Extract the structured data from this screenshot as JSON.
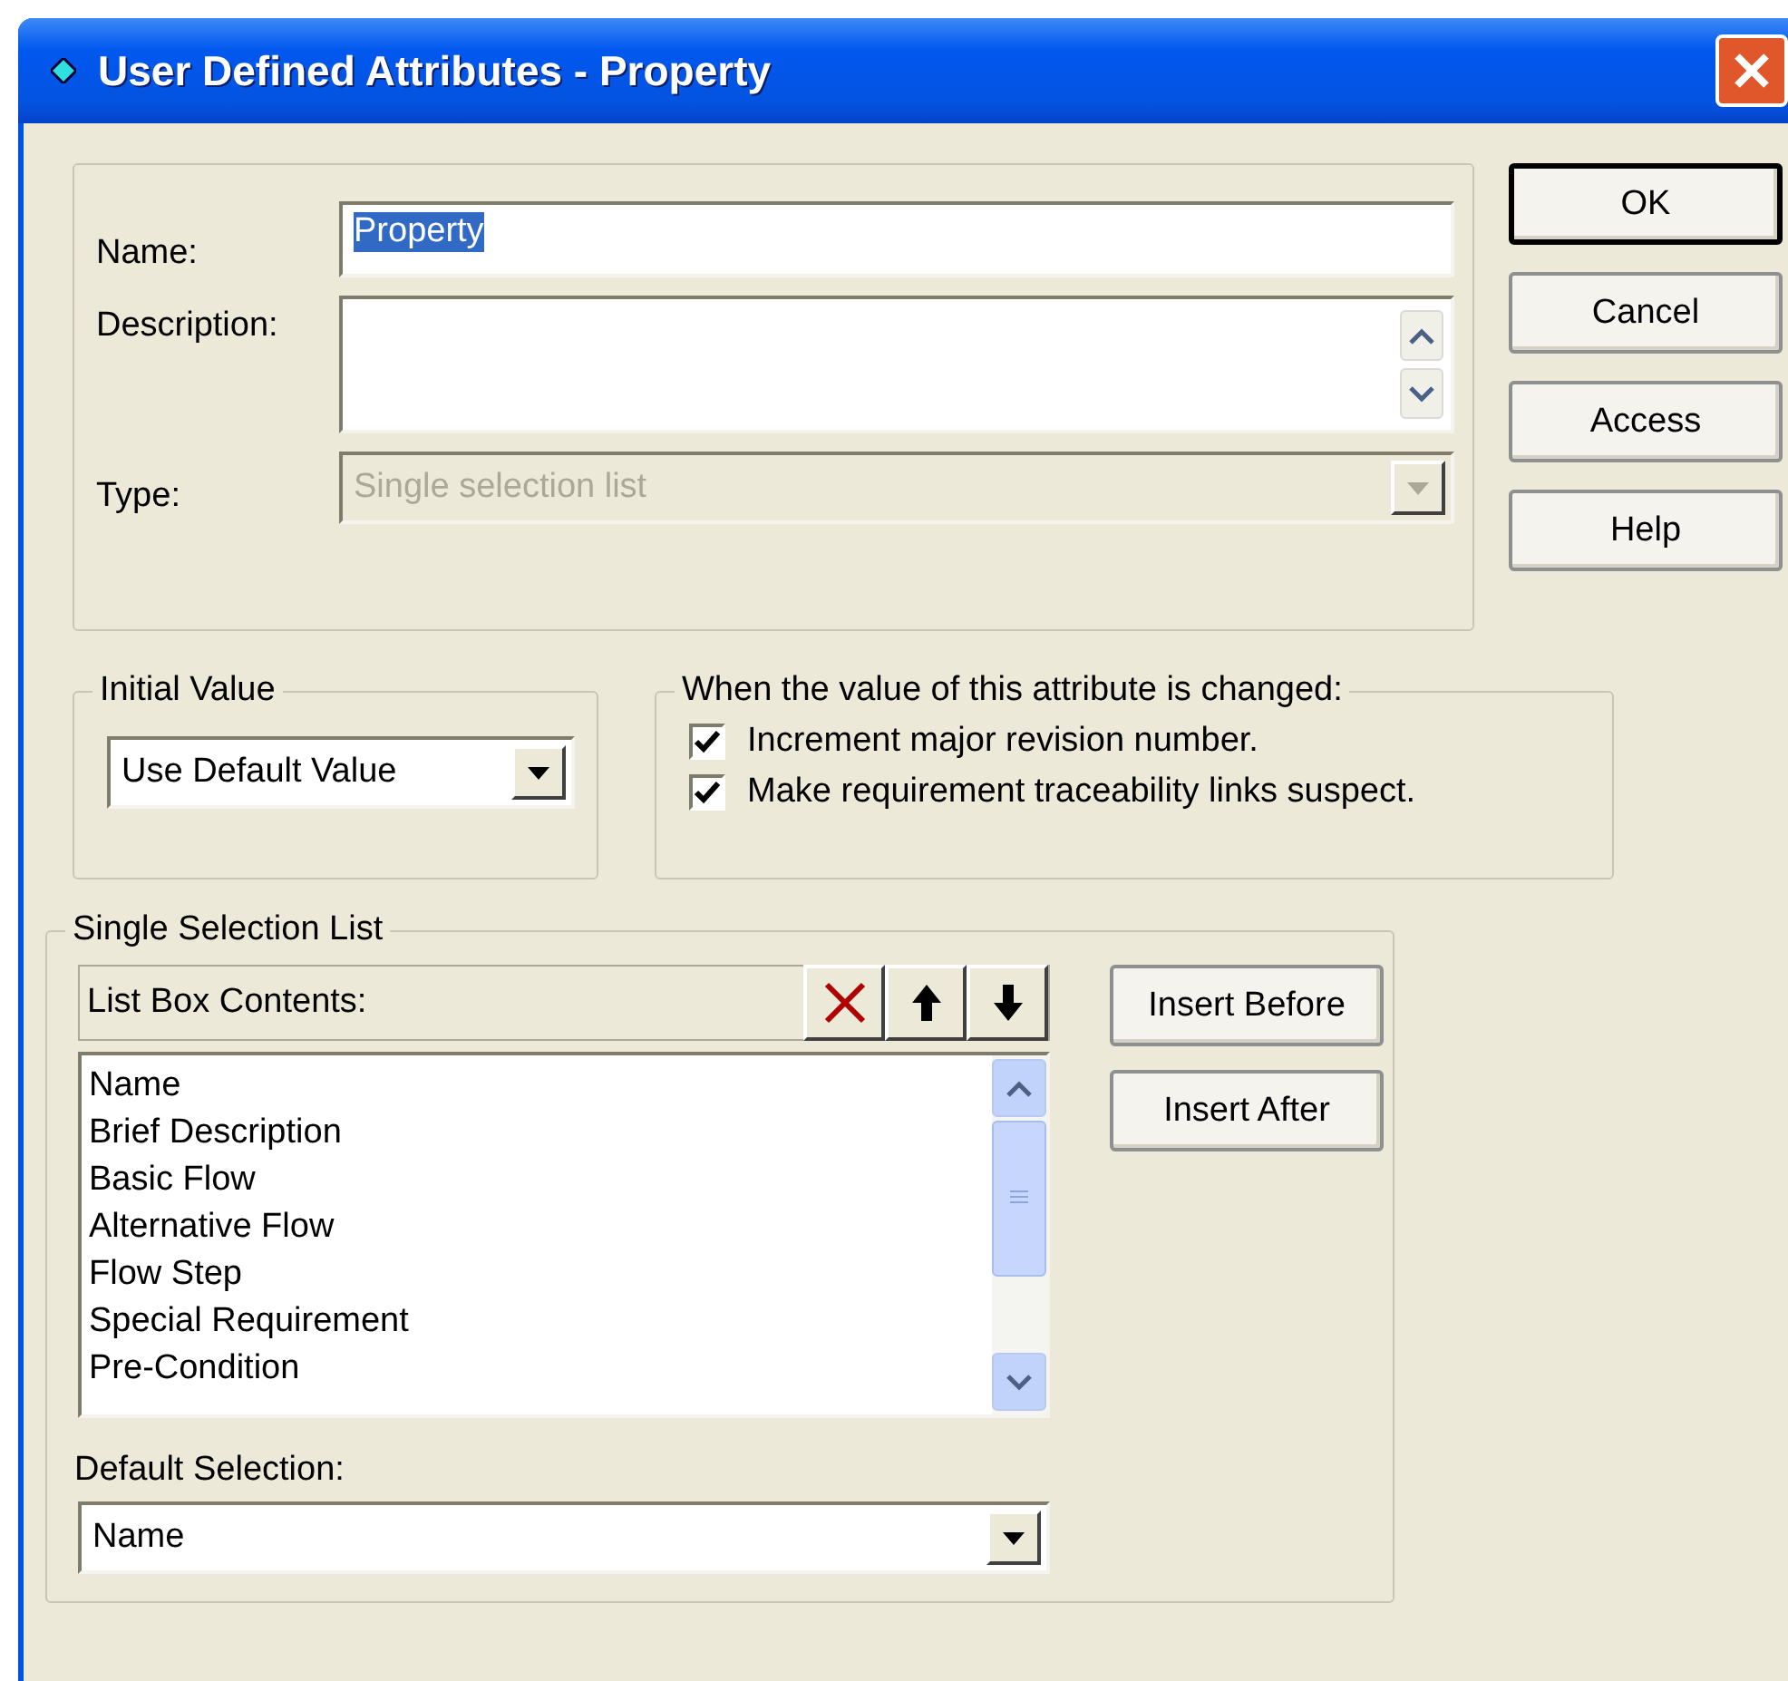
{
  "window": {
    "title": "User Defined Attributes - Property"
  },
  "attribute": {
    "name": {
      "label": "Name:",
      "value": "Property",
      "highlighted": true
    },
    "description": {
      "label": "Description:"
    },
    "type": {
      "label": "Type:",
      "value": "Single selection list",
      "disabled": true
    }
  },
  "buttons": [
    {
      "label": "OK",
      "default": true
    },
    {
      "label": "Cancel",
      "default": false
    },
    {
      "label": "Access",
      "default": false
    },
    {
      "label": "Help",
      "default": false
    }
  ],
  "initial_value": {
    "legend": "Initial Value",
    "value": "Use Default Value"
  },
  "on_change": {
    "legend": "When the value of this attribute is changed:",
    "options": [
      {
        "label": "Increment major revision number.",
        "checked": true
      },
      {
        "label": "Make requirement traceability links suspect.",
        "checked": true
      }
    ]
  },
  "selection_list": {
    "legend": "Single Selection List",
    "toolbar_label": "List Box Contents:",
    "items": [
      "Name",
      "Brief Description",
      "Basic Flow",
      "Alternative Flow",
      "Flow Step",
      "Special Requirement",
      "Pre-Condition"
    ],
    "default_label": "Default Selection:",
    "default_value": "Name",
    "insert_buttons": [
      "Insert Before",
      "Insert After"
    ]
  }
}
